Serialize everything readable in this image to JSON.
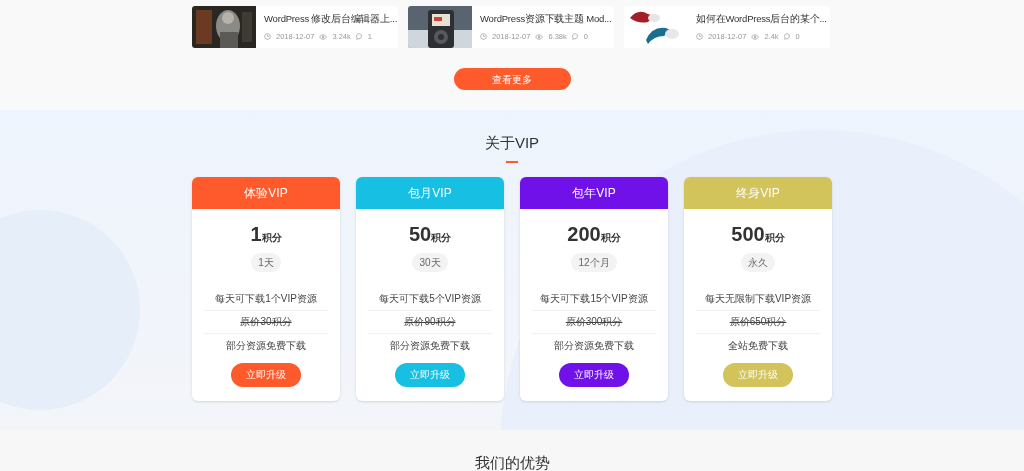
{
  "posts": [
    {
      "title": "WordPress 修改后台编辑器上...",
      "date": "2018-12-07",
      "views": "3.24k",
      "comments": "1"
    },
    {
      "title": "WordPress资源下载主题 Mod...",
      "date": "2018-12-07",
      "views": "6.38k",
      "comments": "0"
    },
    {
      "title": "如何在WordPress后台的某个...",
      "date": "2018-12-07",
      "views": "2.4k",
      "comments": "0"
    }
  ],
  "more_button": "查看更多",
  "vip_section": {
    "title": "关于VIP",
    "plans": [
      {
        "name": "体验VIP",
        "color": "#fe5a2b",
        "price": "1",
        "unit": "积分",
        "period": "1天",
        "features": [
          "每天可下载1个VIP资源",
          "原价30积分",
          "部分资源免费下载"
        ],
        "button": "立即升级"
      },
      {
        "name": "包月VIP",
        "color": "#17bfe3",
        "price": "50",
        "unit": "积分",
        "period": "30天",
        "features": [
          "每天可下载5个VIP资源",
          "原价90积分",
          "部分资源免费下载"
        ],
        "button": "立即升级"
      },
      {
        "name": "包年VIP",
        "color": "#7011e9",
        "price": "200",
        "unit": "积分",
        "period": "12个月",
        "features": [
          "每天可下载15个VIP资源",
          "原价300积分",
          "部分资源免费下载"
        ],
        "button": "立即升级"
      },
      {
        "name": "终身VIP",
        "color": "#d2c35a",
        "price": "500",
        "unit": "积分",
        "period": "永久",
        "features": [
          "每天无限制下载VIP资源",
          "原价650积分",
          "全站免费下载"
        ],
        "button": "立即升级"
      }
    ]
  },
  "advantages_title": "我们的优势"
}
